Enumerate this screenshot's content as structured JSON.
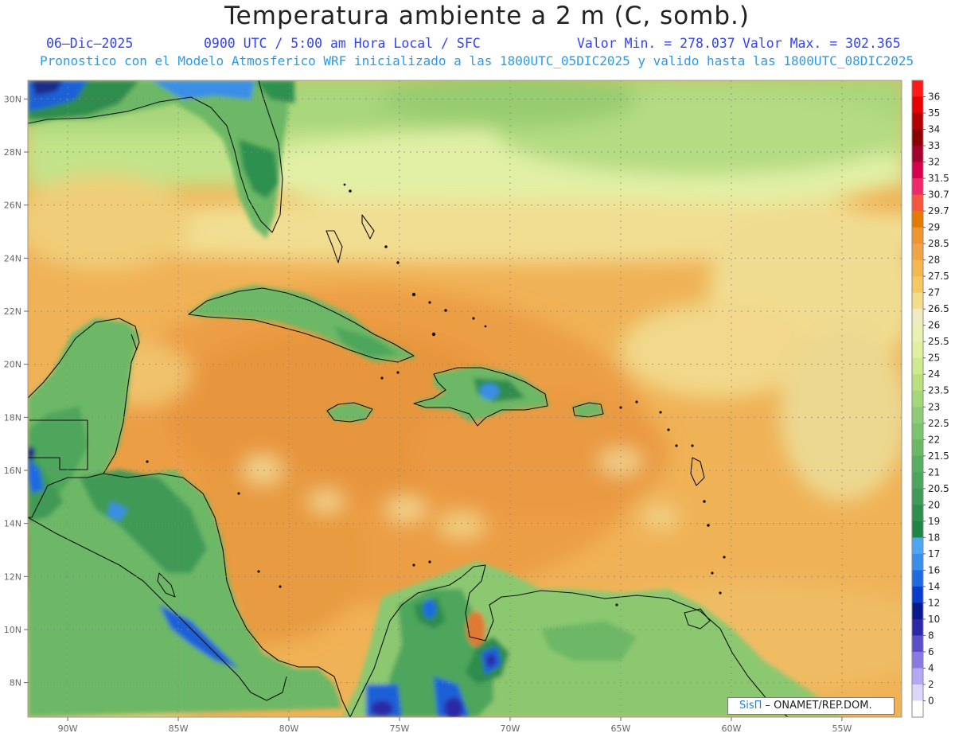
{
  "title": "Temperatura ambiente a 2 m (C, somb.)",
  "subtitle": {
    "date": "06–Dic–2025",
    "time": "0900 UTC / 5:00 am Hora Local / SFC",
    "min": "Valor Min. = 278.037",
    "max": "Valor Max. = 302.365",
    "info": "Pronostico con el Modelo Atmosferico WRF inicializado a las 1800UTC_05DIC2025 y valido hasta las  1800UTC_08DIC2025"
  },
  "map": {
    "lat_labels": [
      "30N",
      "28N",
      "26N",
      "24N",
      "22N",
      "20N",
      "18N",
      "16N",
      "14N",
      "12N",
      "10N",
      "8N"
    ],
    "lon_labels": [
      "90W",
      "85W",
      "80W",
      "75W",
      "70W",
      "65W",
      "60W",
      "55W"
    ],
    "lat_range": [
      6.7,
      30.7
    ],
    "lon_range": [
      -91.8,
      -52.3
    ]
  },
  "colorbar": {
    "labels": [
      "36",
      "35",
      "34",
      "33",
      "32",
      "31.5",
      "30.7",
      "29.7",
      "29",
      "28.5",
      "28",
      "27.5",
      "27",
      "26.5",
      "26",
      "25.5",
      "25",
      "24",
      "23.5",
      "23",
      "22.5",
      "22",
      "21.5",
      "21",
      "20.5",
      "20",
      "19",
      "18",
      "17",
      "16",
      "14",
      "12",
      "10",
      "8",
      "6",
      "4",
      "2",
      "0"
    ],
    "colors": [
      "#ff1a1a",
      "#e60000",
      "#b30000",
      "#8a0000",
      "#a3002e",
      "#d60050",
      "#f0286e",
      "#f5573c",
      "#e67a00",
      "#ee9530",
      "#f0a448",
      "#f4b84e",
      "#f4c862",
      "#f4dc8a",
      "#f0eac0",
      "#eaf0b0",
      "#dff0a0",
      "#cdeb8e",
      "#b8e07c",
      "#a4d67c",
      "#90cc78",
      "#7cc46c",
      "#6ab866",
      "#59ad60",
      "#4ea45c",
      "#3f9a56",
      "#2e8e4e",
      "#1f8446",
      "#4ea6f0",
      "#3b8ee8",
      "#1f6ae0",
      "#0a3ccc",
      "#0a1a8a",
      "#2a2aa8",
      "#5a4ec8",
      "#8a7ae0",
      "#b4a8f0",
      "#dcd6f8",
      "#ffffff"
    ]
  },
  "credit": {
    "brand": "SisΠ",
    "text": " – ONAMET/REP.DOM."
  }
}
